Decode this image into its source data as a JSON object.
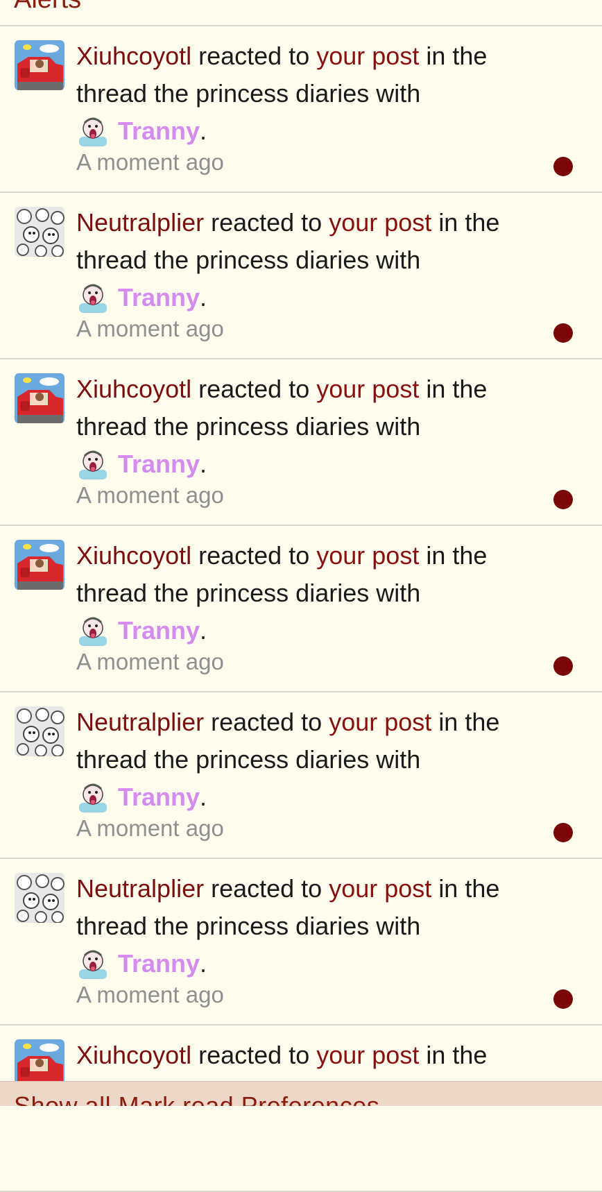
{
  "header": {
    "title": "Alerts"
  },
  "alerts": [
    {
      "user": "Xiuhcoyotl",
      "avatar": "car",
      "action": "reacted to",
      "link": "your post",
      "mid": "in the",
      "thread_line": "thread the princess diaries with",
      "reaction": "Tranny",
      "period": ".",
      "time": "A moment ago"
    },
    {
      "user": "Neutralplier",
      "avatar": "collage",
      "action": "reacted to",
      "link": "your post",
      "mid": "in the",
      "thread_line": "thread the princess diaries with",
      "reaction": "Tranny",
      "period": ".",
      "time": "A moment ago"
    },
    {
      "user": "Xiuhcoyotl",
      "avatar": "car",
      "action": "reacted to",
      "link": "your post",
      "mid": "in the",
      "thread_line": "thread the princess diaries with",
      "reaction": "Tranny",
      "period": ".",
      "time": "A moment ago"
    },
    {
      "user": "Xiuhcoyotl",
      "avatar": "car",
      "action": "reacted to",
      "link": "your post",
      "mid": "in the",
      "thread_line": "thread the princess diaries with",
      "reaction": "Tranny",
      "period": ".",
      "time": "A moment ago"
    },
    {
      "user": "Neutralplier",
      "avatar": "collage",
      "action": "reacted to",
      "link": "your post",
      "mid": "in the",
      "thread_line": "thread the princess diaries with",
      "reaction": "Tranny",
      "period": ".",
      "time": "A moment ago"
    },
    {
      "user": "Neutralplier",
      "avatar": "collage",
      "action": "reacted to",
      "link": "your post",
      "mid": "in the",
      "thread_line": "thread the princess diaries with",
      "reaction": "Tranny",
      "period": ".",
      "time": "A moment ago"
    },
    {
      "user": "Xiuhcoyotl",
      "avatar": "car",
      "action": "reacted to",
      "link": "your post",
      "mid": "in the"
    }
  ],
  "footer": {
    "links": "Show all   Mark read   Preferences"
  },
  "colors": {
    "username": "#7a0e0e",
    "reaction": "#d48bf0",
    "unread_dot": "#7a0606",
    "background": "#fefdee"
  }
}
